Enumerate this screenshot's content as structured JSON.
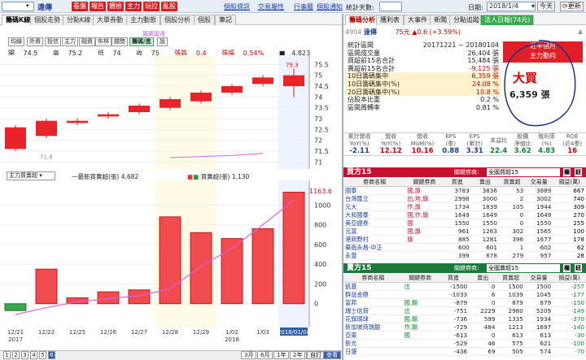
{
  "topbar": {
    "ticker": "",
    "name": "遠傳",
    "buttons": [
      "看盤",
      "報告",
      "體檢",
      "主力",
      "玩拉",
      "亂股"
    ],
    "links": [
      "個股資訊",
      "交易屬性",
      "行事曆",
      "個股通知"
    ]
  },
  "left_tabs": [
    "籌碼K線",
    "個股走勢",
    "分點K線",
    "大單券動",
    "主力動態",
    "個股分析",
    "個股",
    "筆記"
  ],
  "indicators": [
    "均線",
    "外資",
    "投信",
    "主力",
    "融資",
    "布林",
    "趨勢",
    "籌碼/進",
    "設"
  ],
  "watermark": "籌碼雷達",
  "ohlc": {
    "open_label": "開",
    "open": "74.5",
    "high_label": "高",
    "high": "75.2",
    "low_label": "低",
    "low": "74",
    "close_label": "收",
    "close": "75",
    "chg_label": "張跌",
    "chg": "0.4",
    "pct_label": "張幅",
    "pct": "0.54%",
    "vol": "4,823"
  },
  "price_axis": [
    "75.5",
    "75",
    "74.5",
    "74",
    "73.5",
    "73",
    "72.5",
    "72",
    "71.5",
    "71"
  ],
  "price_tags": {
    "high": "75.3",
    "low": "71.8"
  },
  "sub_indicator": {
    "select": "主力買賣超",
    "legend1_label": "一最新買賣超(張)",
    "legend1_value": "4,682",
    "legend2_label": "買賣超(張)",
    "legend2_value": "1,130",
    "right_value": "1163.6"
  },
  "vol_axis": [
    "1000",
    "800",
    "600",
    "400",
    "200",
    "0"
  ],
  "chart_data": [
    {
      "type": "candlestick",
      "categories": [
        "12/21",
        "12/22",
        "12/25",
        "12/26",
        "12/27",
        "12/28",
        "12/29",
        "1/02",
        "1/03",
        "2018/01/04"
      ],
      "open": [
        71.6,
        72.2,
        72.8,
        73.1,
        73.3,
        73.5,
        73.8,
        74.2,
        74.6,
        74.5
      ],
      "close": [
        72.6,
        72.9,
        72.9,
        73.2,
        73.6,
        73.9,
        74.2,
        74.5,
        74.9,
        75.0
      ],
      "high": [
        72.7,
        73.0,
        73.0,
        73.3,
        73.7,
        74.0,
        74.3,
        74.6,
        75.0,
        75.3
      ],
      "low": [
        71.5,
        72.1,
        72.7,
        73.0,
        73.2,
        73.4,
        73.7,
        74.1,
        74.5,
        74.0
      ],
      "line": [
        null,
        null,
        null,
        null,
        null,
        71.2,
        71.25,
        71.3,
        71.4,
        null
      ]
    },
    {
      "type": "bar",
      "categories": [
        "12/21",
        "12/22",
        "12/25",
        "12/26",
        "12/27",
        "12/28",
        "12/29",
        "1/02",
        "1/03",
        "2018/01/04"
      ],
      "values": [
        -70,
        350,
        60,
        120,
        140,
        880,
        720,
        660,
        760,
        1130
      ],
      "line": [
        -110,
        -40,
        20,
        50,
        80,
        150,
        380,
        560,
        800,
        1050
      ],
      "ylim": [
        -200,
        1200
      ]
    }
  ],
  "x_years": {
    "first": "2017",
    "mid": "2018"
  },
  "bottom": {
    "pages": [
      "1",
      "2",
      "3",
      "4",
      "5",
      "6"
    ],
    "ranges": [
      "3月",
      "6月",
      "1年",
      "2年",
      "3年"
    ],
    "active_range": "自訂",
    "extra": "查看"
  },
  "right_top": {
    "stat_label": "統計天數:",
    "date_label": "日期:",
    "date": "2018/1/4",
    "query": "今天",
    "refresh": "更新"
  },
  "right_tabs": [
    "籌碼分析",
    "獲利表",
    "大事件",
    "新聞",
    "分點追蹤",
    "法人日報(74元)"
  ],
  "stock_line": {
    "code": "4904",
    "name": "遠傳",
    "price": "75元",
    "change": "▲0.6 (+3.59%)"
  },
  "summary_rows": [
    {
      "label": "統計區間",
      "value": "20171221 ~ 20180104"
    },
    {
      "label": "區間成交量",
      "value": "26,404 張"
    },
    {
      "label": "買超前15名合計",
      "value": "15,484 張"
    },
    {
      "label": "賣超前15名合計",
      "value": "-9,125 張"
    },
    {
      "label": "10日籌碼集中",
      "value": "6,359 張"
    },
    {
      "label": "10日籌碼集中(%)",
      "value": "24.08 %"
    },
    {
      "label": "20日籌碼集中(%)",
      "value": "10.8 %"
    },
    {
      "label": "佔股本比重",
      "value": "0.2 %"
    },
    {
      "label": "區間周轉率",
      "value": "0.81 %"
    }
  ],
  "recent": {
    "line1": "近半個月",
    "line2": "主力動向",
    "big": "大買",
    "amount": "6,359 張"
  },
  "kpi": [
    {
      "label": "累計營收\nYoY(%)",
      "value": "-2.11"
    },
    {
      "label": "營收\nYoY(%)",
      "value": "12.12"
    },
    {
      "label": "營收\nMoM(%)",
      "value": "10.16"
    },
    {
      "label": "EPS\n(季)",
      "value": "0.88"
    },
    {
      "label": "EPS\n(累計)",
      "value": "3.31"
    },
    {
      "label": "本益比",
      "value": "22.4"
    },
    {
      "label": "股價\n淨值比",
      "value": "3.62"
    },
    {
      "label": "殖利率\n(%)",
      "value": "4.83"
    },
    {
      "label": "ROE\n(近4季)",
      "value": "16"
    }
  ],
  "buy": {
    "title": "買方15",
    "select_label": "關鍵券商:",
    "select": "全國買超15",
    "btn1": "欄",
    "btn2": "鈕",
    "headers": [
      "券商名稱",
      "關鍵券商",
      "買進",
      "賣出",
      "買賣超",
      "交易量",
      "損益(萬)"
    ],
    "rows": [
      [
        "國泰",
        "國,旗",
        "3783",
        "3836",
        "53",
        "3889",
        "667"
      ],
      [
        "台灣匯立",
        "出,地,旗",
        "2998",
        "3000",
        "2",
        "3002",
        "740"
      ],
      [
        "元大",
        "作,旗",
        "1734",
        "1839",
        "105",
        "1944",
        "309"
      ],
      [
        "大和國泰",
        "國,作,旗",
        "1649",
        "1649",
        "0",
        "1649",
        "270"
      ],
      [
        "美亞證券",
        "國",
        "1550",
        "1550",
        "0",
        "1550",
        "255"
      ],
      [
        "元富",
        "國,旗",
        "961",
        "1263",
        "302",
        "1565",
        "100"
      ],
      [
        "港商野村",
        "旗",
        "885",
        "1281",
        "396",
        "1677",
        "178"
      ],
      [
        "華南永昌-中正",
        "",
        "600",
        "601",
        "1",
        "602",
        "62"
      ],
      [
        "永豐",
        "",
        "399",
        "678",
        "279",
        "957",
        "28"
      ]
    ]
  },
  "sell": {
    "title": "賣方15",
    "select_label": "關鍵券商:",
    "select": "全國賣超15",
    "btn1": "欄",
    "btn2": "鈕",
    "headers": [
      "券商名稱",
      "關鍵券商",
      "買進",
      "賣出",
      "買賣超",
      "交易量",
      "損益(萬)"
    ],
    "rows": [
      [
        "凱基",
        "出",
        "-1500",
        "0",
        "1500",
        "1500",
        "-257"
      ],
      [
        "群益金鼎",
        "",
        "-1033",
        "6",
        "1039",
        "1045",
        "-177"
      ],
      [
        "富邦",
        "國,輸",
        "-879",
        "0",
        "879",
        "879",
        "-150"
      ],
      [
        "瑞士信貸",
        "出",
        "-751",
        "2229",
        "2980",
        "5209",
        "-149"
      ],
      [
        "花旗環球",
        "國,輸",
        "-736",
        "599",
        "1335",
        "1934",
        "-370"
      ],
      [
        "新加坡商瑞銀",
        "作,輸",
        "-729",
        "484",
        "1213",
        "1697",
        "-140"
      ],
      [
        "亞東",
        "國",
        "-613",
        "0",
        "613",
        "613",
        "-30"
      ],
      [
        "新光",
        "",
        "-529",
        "46",
        "575",
        "621",
        "-100"
      ],
      [
        "日盛",
        "",
        "-436",
        "69",
        "505",
        "574",
        "-70"
      ]
    ]
  },
  "colors": {
    "up": "#e8383d",
    "down": "#2a9b3b",
    "accent": "#315ea8",
    "buy_header": "#c8102e",
    "sell_header": "#1b7a3a"
  }
}
